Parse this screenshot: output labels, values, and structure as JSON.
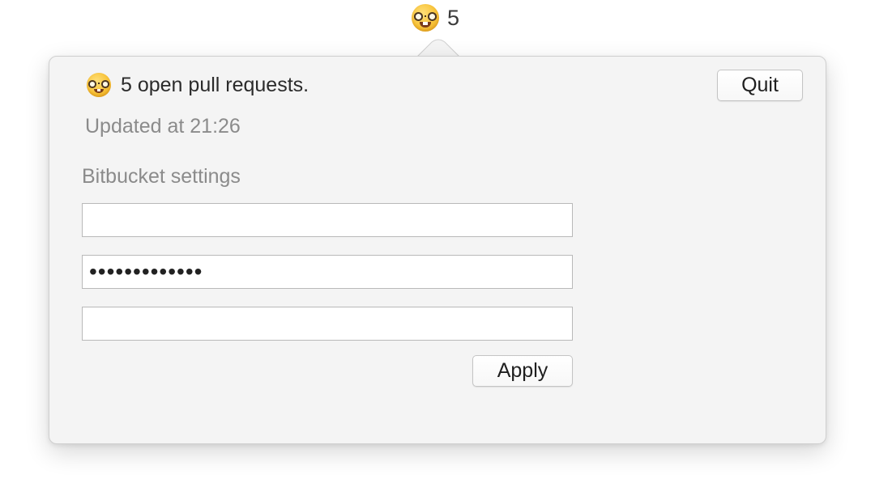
{
  "menubar": {
    "icon": "nerd-face-emoji",
    "count": "5"
  },
  "popover": {
    "status_icon": "nerd-face-emoji",
    "status_text": "5 open pull requests.",
    "updated_text": "Updated at 21:26",
    "quit_label": "Quit",
    "settings_title": "Bitbucket settings",
    "fields": [
      {
        "value": "",
        "type": "text"
      },
      {
        "value": "•••••••••••••",
        "type": "password"
      },
      {
        "value": "",
        "type": "text"
      }
    ],
    "apply_label": "Apply"
  },
  "colors": {
    "popover_bg": "#f4f4f4",
    "secondary_text": "#8b8b8b",
    "primary_text": "#2b2b2b"
  }
}
